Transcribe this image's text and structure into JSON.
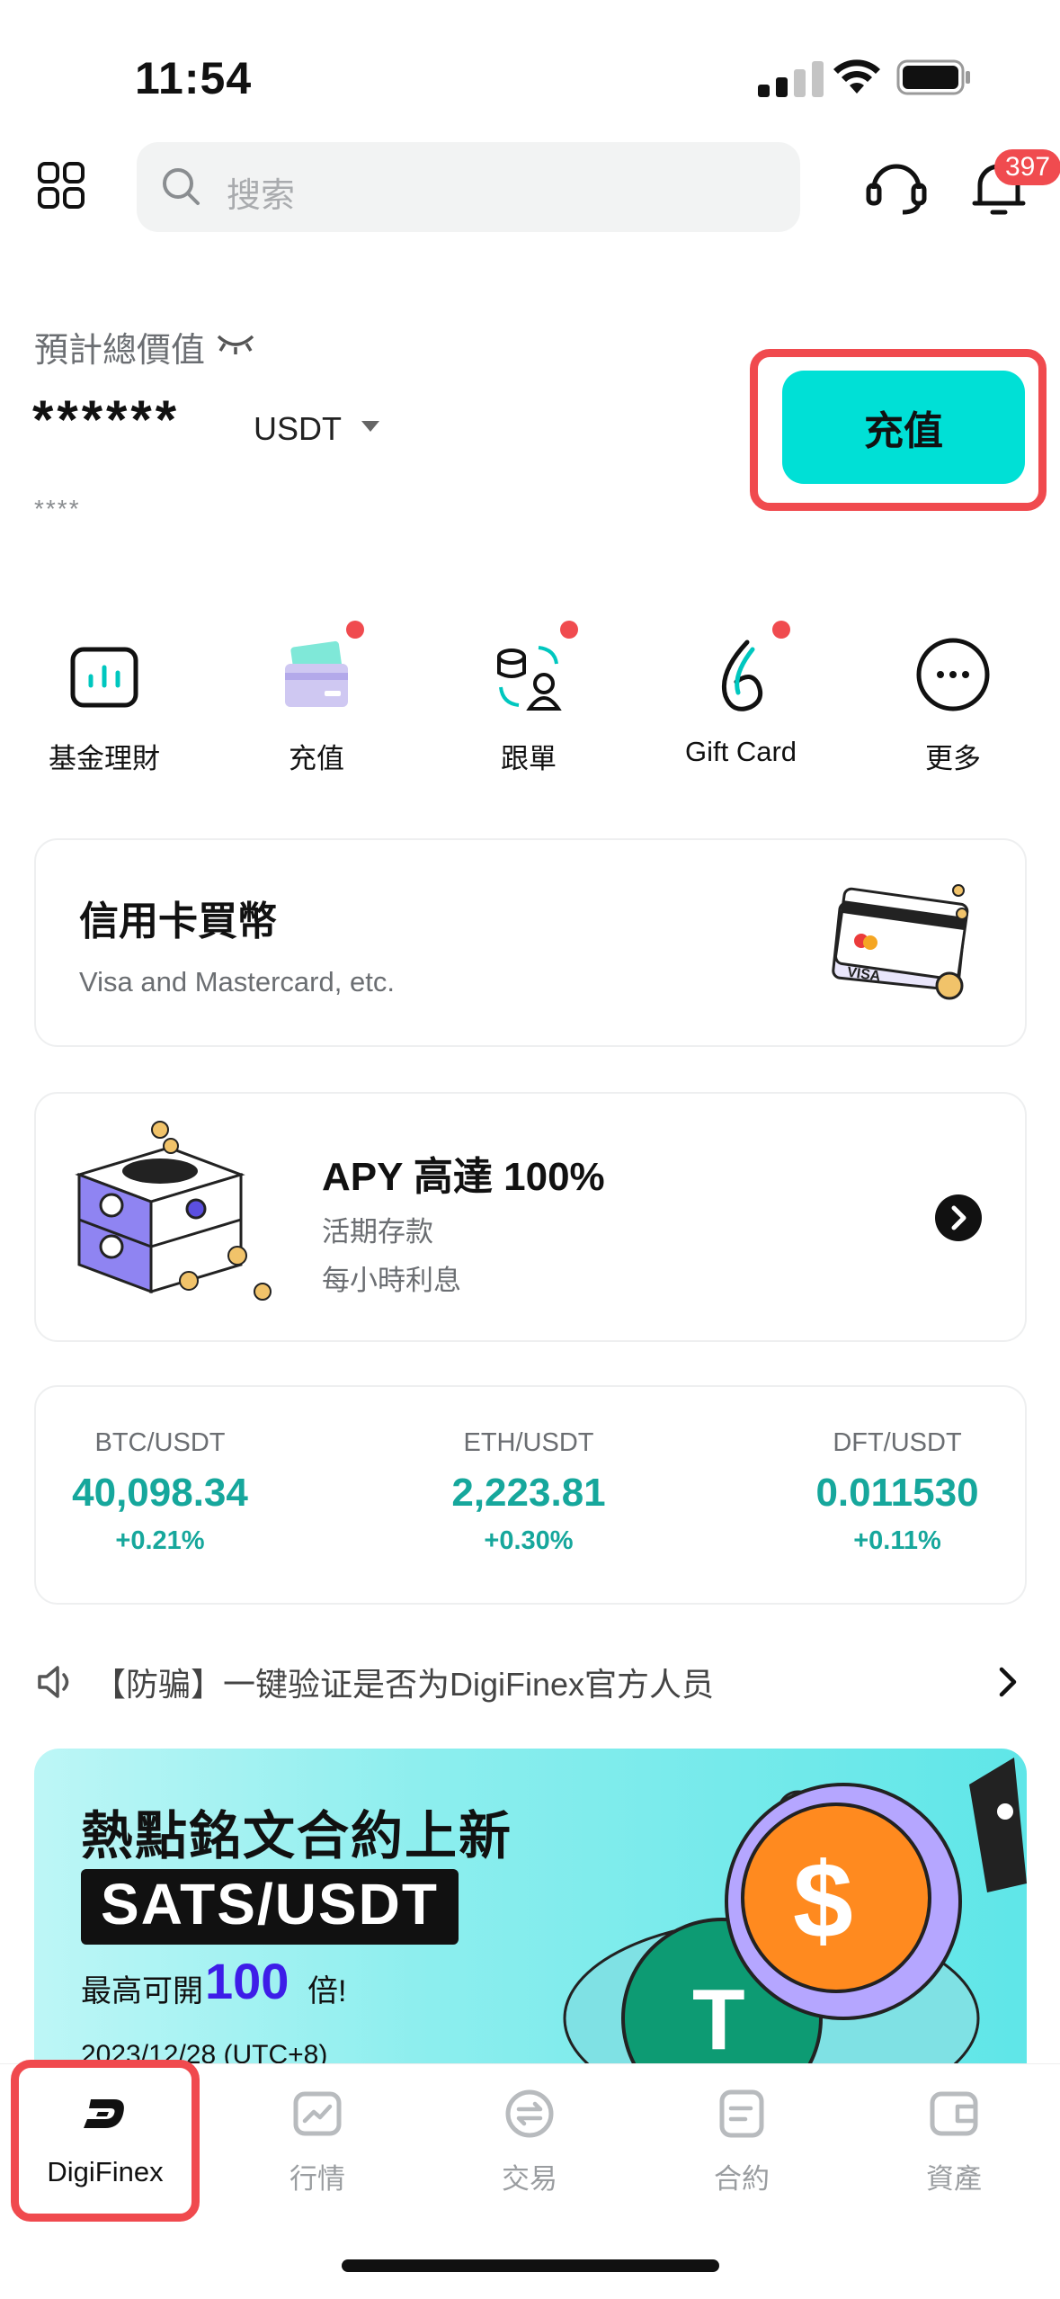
{
  "status_bar": {
    "time": "11:54"
  },
  "header": {
    "search_placeholder": "搜索",
    "notification_count": "397"
  },
  "balance": {
    "label": "預計總價值",
    "masked_value": "******",
    "currency": "USDT",
    "masked_sub": "****"
  },
  "deposit_button": "充值",
  "quick_actions": [
    {
      "label": "基金理財",
      "icon": "fund-chart-icon",
      "dot": false
    },
    {
      "label": "充值",
      "icon": "card-deposit-icon",
      "dot": true
    },
    {
      "label": "跟單",
      "icon": "copy-trade-icon",
      "dot": true
    },
    {
      "label": "Gift Card",
      "icon": "gift-card-icon",
      "dot": true
    },
    {
      "label": "更多",
      "icon": "more-icon",
      "dot": false
    }
  ],
  "credit_card": {
    "title": "信用卡買幣",
    "subtitle": "Visa and Mastercard, etc.",
    "card_text": "VISA"
  },
  "savings": {
    "title": "APY 高達 100%",
    "line1": "活期存款",
    "line2": "每小時利息"
  },
  "tickers": [
    {
      "pair": "BTC/USDT",
      "price": "40,098.34",
      "change": "+0.21%"
    },
    {
      "pair": "ETH/USDT",
      "price": "2,223.81",
      "change": "+0.30%"
    },
    {
      "pair": "DFT/USDT",
      "price": "0.011530",
      "change": "+0.11%"
    }
  ],
  "notice": {
    "text": "【防骗】一键验证是否为DigiFinex官方人员"
  },
  "banner": {
    "title": "熱點銘文合約上新",
    "pair": "SATS/USDT",
    "line_prefix": "最高可開",
    "big": "100",
    "line_suffix": "倍!",
    "date": "2023/12/28 (UTC+8)"
  },
  "tabs": [
    {
      "label": "DigiFinex",
      "icon": "digifinex-logo-icon",
      "active": true
    },
    {
      "label": "行情",
      "icon": "market-chart-icon",
      "active": false
    },
    {
      "label": "交易",
      "icon": "exchange-icon",
      "active": false
    },
    {
      "label": "合約",
      "icon": "contract-icon",
      "active": false
    },
    {
      "label": "資產",
      "icon": "wallet-icon",
      "active": false
    }
  ],
  "colors": {
    "accent": "#00e0d6",
    "up": "#16a79c",
    "alert": "#f04b4f"
  }
}
